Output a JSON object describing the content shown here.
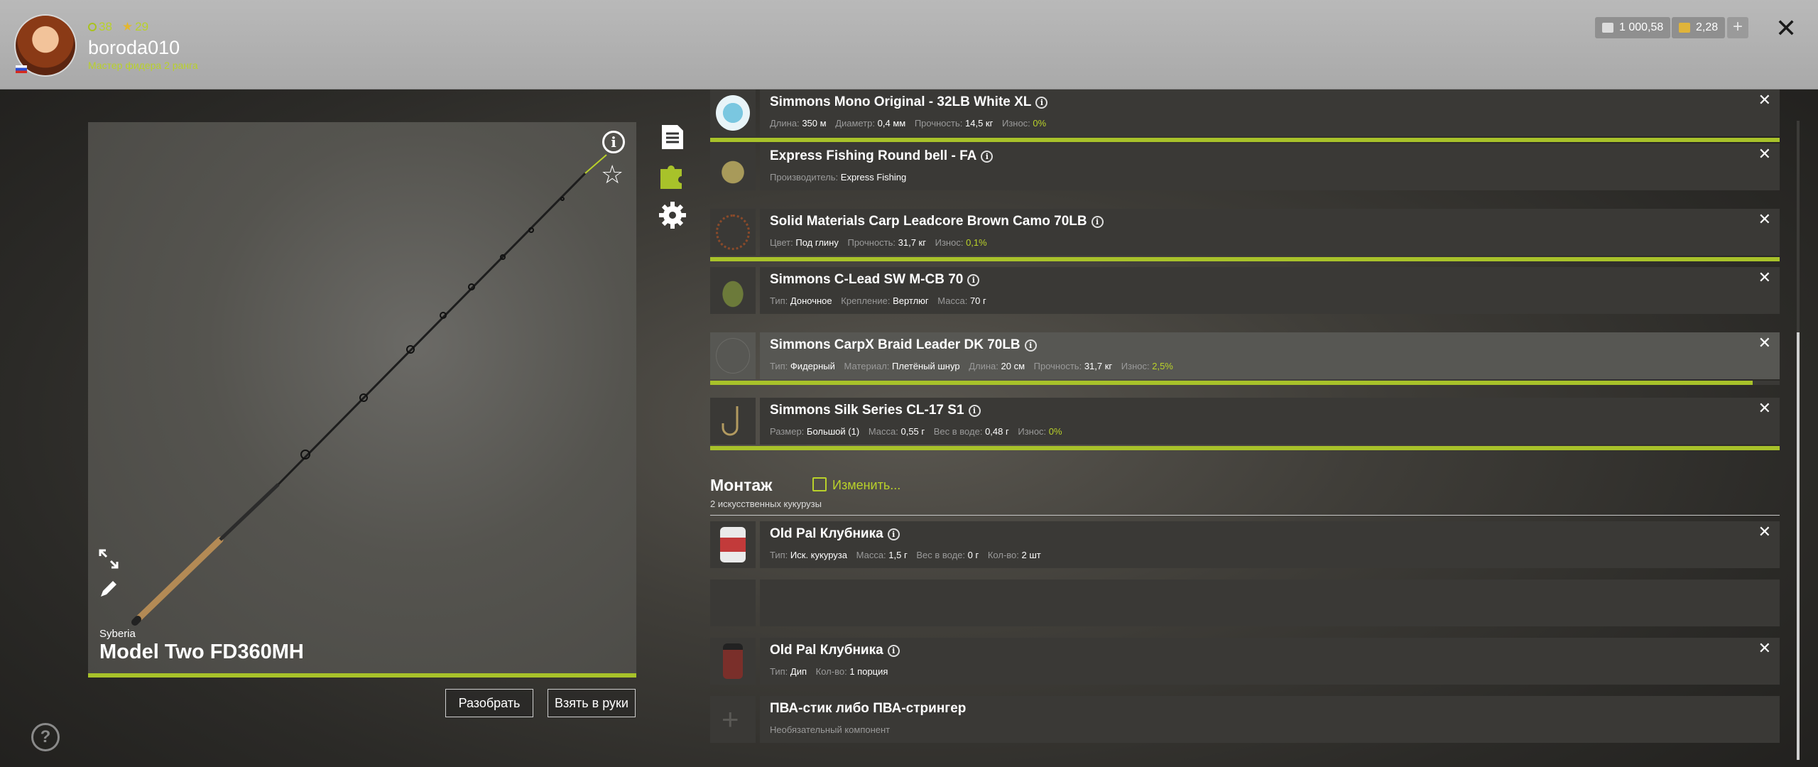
{
  "profile": {
    "level": "38",
    "stars": "29",
    "username": "boroda010",
    "rank": "Мастер фидера 2 ранга"
  },
  "currency": {
    "silver": "1 000,58",
    "gold": "2,28",
    "plus": "+"
  },
  "close_symbol": "✕",
  "rod": {
    "brand": "Syberia",
    "name": "Model Two FD360MH",
    "disassemble_label": "Разобрать",
    "take_label": "Взять в руки"
  },
  "help_symbol": "?",
  "items": [
    {
      "title": "Simmons Mono Original - 32LB White XL",
      "meta": [
        {
          "k": "Длина:",
          "v": "350 м"
        },
        {
          "k": "Диаметр:",
          "v": "0,4 мм"
        },
        {
          "k": "Прочность:",
          "v": "14,5 кг"
        },
        {
          "k": "Износ:",
          "v": "0%",
          "green": true
        }
      ],
      "wear_fraction": 1.0
    },
    {
      "title": "Express Fishing Round bell - FA",
      "meta": [
        {
          "k": "Производитель:",
          "v": "Express Fishing"
        }
      ]
    },
    {
      "title": "Solid Materials Carp Leadcore Brown Camo 70LB",
      "meta": [
        {
          "k": "Цвет:",
          "v": "Под глину"
        },
        {
          "k": "Прочность:",
          "v": "31,7 кг"
        },
        {
          "k": "Износ:",
          "v": "0,1%",
          "green": true
        }
      ],
      "wear_fraction": 1.0
    },
    {
      "title": "Simmons C-Lead SW M-CB 70",
      "meta": [
        {
          "k": "Тип:",
          "v": "Доночное"
        },
        {
          "k": "Крепление:",
          "v": "Вертлюг"
        },
        {
          "k": "Масса:",
          "v": "70 г"
        }
      ]
    },
    {
      "title": "Simmons CarpX Braid Leader DK 70LB",
      "meta": [
        {
          "k": "Тип:",
          "v": "Фидерный"
        },
        {
          "k": "Материал:",
          "v": "Плетёный шнур"
        },
        {
          "k": "Длина:",
          "v": "20 см"
        },
        {
          "k": "Прочность:",
          "v": "31,7 кг"
        },
        {
          "k": "Износ:",
          "v": "2,5%",
          "green": true
        }
      ],
      "wear_fraction": 0.975
    },
    {
      "title": "Simmons Silk Series CL-17 S1",
      "meta": [
        {
          "k": "Размер:",
          "v": "Большой (1)"
        },
        {
          "k": "Масса:",
          "v": "0,55 г"
        },
        {
          "k": "Вес в воде:",
          "v": "0,48 г"
        },
        {
          "k": "Износ:",
          "v": "0%",
          "green": true
        }
      ],
      "wear_fraction": 1.0
    }
  ],
  "montage": {
    "title": "Монтаж",
    "edit_label": "Изменить...",
    "subtitle": "2 искусственных кукурузы"
  },
  "baits": [
    {
      "title": "Old Pal Клубника",
      "meta": [
        {
          "k": "Тип:",
          "v": "Иск. кукуруза"
        },
        {
          "k": "Масса:",
          "v": "1,5 г"
        },
        {
          "k": "Вес в воде:",
          "v": "0 г"
        },
        {
          "k": "Кол-во:",
          "v": "2 шт"
        }
      ]
    },
    {
      "title": "Old Pal Клубника",
      "meta": [
        {
          "k": "Тип:",
          "v": "Дип"
        },
        {
          "k": "Кол-во:",
          "v": "1 порция"
        }
      ]
    },
    {
      "title": "ПВА-стик либо ПВА-стрингер",
      "meta": [
        {
          "k": "",
          "v": "Необязательный компонент",
          "muted": true
        }
      ]
    }
  ],
  "colors": {
    "accent": "#a8c22a",
    "topbar": "#b0b0b0",
    "row": "#3a3936"
  }
}
